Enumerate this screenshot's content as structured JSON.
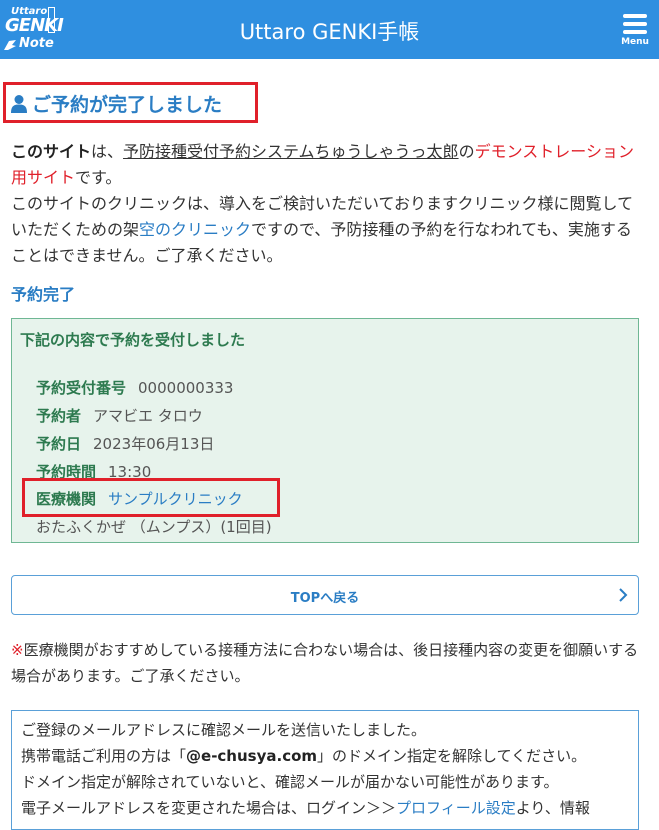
{
  "header": {
    "logo": {
      "line1": "Uttaro",
      "line2": "GENKI",
      "line3": "Note"
    },
    "title": "Uttaro GENKI手帳",
    "menu_label": "Menu",
    "bg_color": "#2f8fe0"
  },
  "page_title": "ご予約が完了しました",
  "intro": {
    "p1_bold": "このサイト",
    "p1_a": "は、",
    "p1_link": "予防接種受付予約システムちゅうしゃうっ太郎",
    "p1_b": "の",
    "p1_red": "デモンストレーション用サイト",
    "p1_c": "です。",
    "p2_a": "このサイトのクリニックは、導入をご検討いただいておりますクリニック様に閲覧していただくための架",
    "p2_blue": "空のクリニック",
    "p2_b": "ですので、予防接種の予約を行なわれても、実施することはできません。ご了承ください。"
  },
  "section_title": "予約完了",
  "panel": {
    "title": "下記の内容で予約を受付しました",
    "rows": [
      {
        "key": "予約受付番号",
        "value": "0000000333"
      },
      {
        "key": "予約者",
        "value": "アマビエ タロウ"
      },
      {
        "key": "予約日",
        "value": "2023年06月13日"
      },
      {
        "key": "予約時間",
        "value": "13:30"
      },
      {
        "key": "医療機関",
        "value": "サンプルクリニック"
      }
    ],
    "vaccine": "おたふくかぜ （ムンプス）(1回目)"
  },
  "top_button": "TOPへ戻る",
  "note": {
    "mark": "※",
    "text": "医療機関がおすすめしている接種方法に合わない場合は、後日接種内容の変更を御願いする場合があります。ご了承ください。"
  },
  "mail": {
    "l1": "ご登録のメールアドレスに確認メールを送信いたしました。",
    "l2a": "携帯電話ご利用の方は「",
    "l2b": "@e-chusya.com",
    "l2c": "」のドメイン指定を解除してください。",
    "l3": "ドメイン指定が解除されていないと、確認メールが届かない可能性があります。",
    "l4a": "電子メールアドレスを変更された場合は、ログイン＞＞",
    "l4b": "プロフィール設定",
    "l4c": "より、情報"
  }
}
